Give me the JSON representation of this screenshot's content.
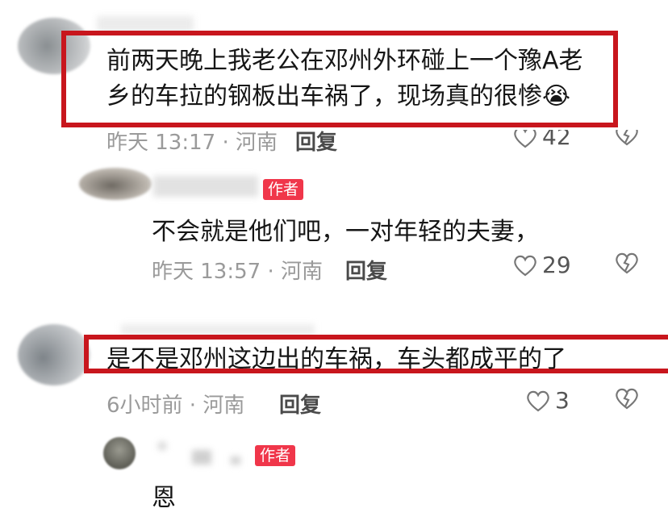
{
  "comments": [
    {
      "text_line1": "前两天晚上我老公在邓州外环碰上一个豫A老",
      "text_line2": "乡的车拉的钢板出车祸了，现场真的很惨😭",
      "meta": "昨天 13:17 · 河南",
      "reply_label": "回复",
      "likes": "42",
      "reply": {
        "badge": "作者",
        "text": "不会就是他们吧，一对年轻的夫妻，",
        "meta": "昨天 13:57 · 河南",
        "reply_label": "回复",
        "likes": "29"
      }
    },
    {
      "text": "是不是邓州这边出的车祸，车头都成平的了",
      "meta": "6小时前 · 河南",
      "reply_label": "回复",
      "likes": "3",
      "reply": {
        "badge": "作者",
        "text": "恩"
      }
    }
  ],
  "colors": {
    "highlight": "#c8161d",
    "badge": "#f0364a"
  },
  "icons": [
    "heart-icon",
    "dislike-heart-icon"
  ]
}
